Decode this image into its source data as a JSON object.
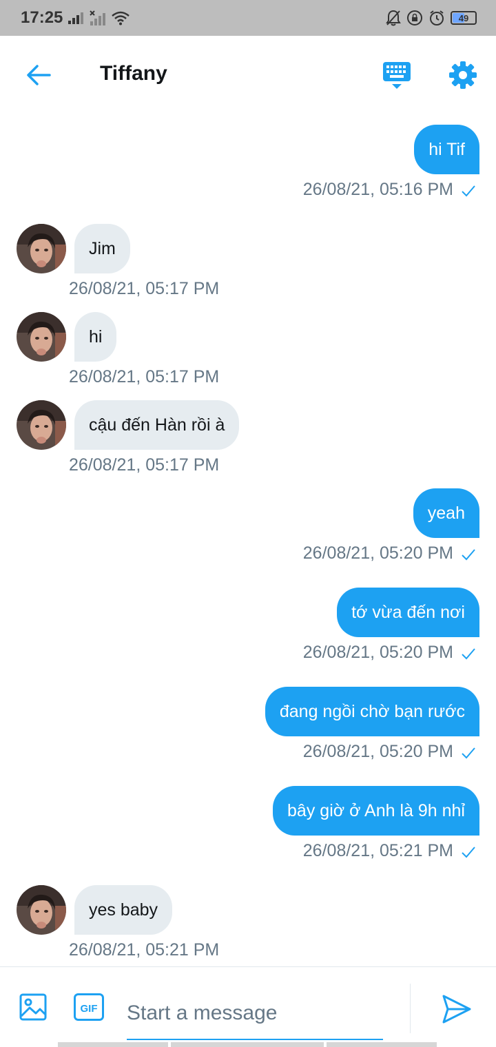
{
  "status_bar": {
    "time": "17:25",
    "battery": "49"
  },
  "header": {
    "title": "Tiffany"
  },
  "messages": [
    {
      "direction": "out",
      "text": "hi Tif",
      "time": "26/08/21, 05:16 PM"
    },
    {
      "direction": "in",
      "text": "Jim",
      "time": "26/08/21, 05:17 PM"
    },
    {
      "direction": "in",
      "text": "hi",
      "time": "26/08/21, 05:17 PM"
    },
    {
      "direction": "in",
      "text": "cậu đến Hàn rồi à",
      "time": "26/08/21, 05:17 PM"
    },
    {
      "direction": "out",
      "text": "yeah",
      "time": "26/08/21, 05:20 PM"
    },
    {
      "direction": "out",
      "text": "tớ vừa đến nơi",
      "time": "26/08/21, 05:20 PM"
    },
    {
      "direction": "out",
      "text": "đang ngồi chờ bạn rước",
      "time": "26/08/21, 05:20 PM"
    },
    {
      "direction": "out",
      "text": "bây giờ ở Anh là 9h nhỉ",
      "time": "26/08/21, 05:21 PM"
    },
    {
      "direction": "in",
      "text": "yes baby",
      "time": "26/08/21, 05:21 PM"
    }
  ],
  "composer": {
    "placeholder": "Start a message",
    "gif_label": "GIF"
  },
  "colors": {
    "accent": "#1da1f2",
    "incoming_bubble": "#e6ecf0",
    "timestamp": "#657786"
  }
}
